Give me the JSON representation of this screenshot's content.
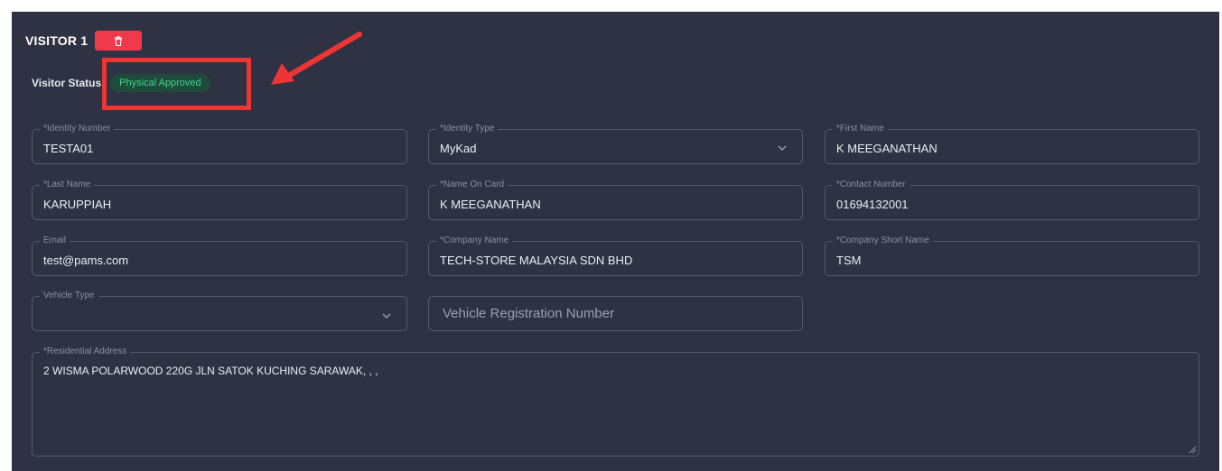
{
  "visitor": {
    "title": "VISITOR 1",
    "status_label": "Visitor Status:",
    "status_value": "Physical Approved"
  },
  "fields": {
    "identity_number": {
      "label": "*Identity Number",
      "value": "TESTA01"
    },
    "identity_type": {
      "label": "*Identity Type",
      "value": "MyKad"
    },
    "first_name": {
      "label": "*First Name",
      "value": "K MEEGANATHAN"
    },
    "last_name": {
      "label": "*Last Name",
      "value": "KARUPPIAH"
    },
    "name_on_card": {
      "label": "*Name On Card",
      "value": "K MEEGANATHAN"
    },
    "contact_number": {
      "label": "*Contact Number",
      "value": "01694132001"
    },
    "email": {
      "label": "Email",
      "value": "test@pams.com"
    },
    "company_name": {
      "label": "*Company Name",
      "value": "TECH-STORE MALAYSIA SDN BHD"
    },
    "company_short_name": {
      "label": "*Company Short Name",
      "value": "TSM"
    },
    "vehicle_type": {
      "label": "Vehicle Type",
      "value": ""
    },
    "vehicle_registration": {
      "placeholder": "Vehicle Registration Number",
      "value": ""
    },
    "residential_address": {
      "label": "*Residential Address",
      "value": "2 WISMA POLARWOOD 220G JLN SATOK KUCHING SARAWAK, , ,"
    }
  },
  "icons": {
    "delete": "trash-icon",
    "dropdown": "chevron-down-icon"
  },
  "colors": {
    "background": "#2f3243",
    "delete_button": "#f0394a",
    "status_text": "#3ed48d",
    "status_bg": "#1f4b3c",
    "annotation": "#ee3536"
  }
}
